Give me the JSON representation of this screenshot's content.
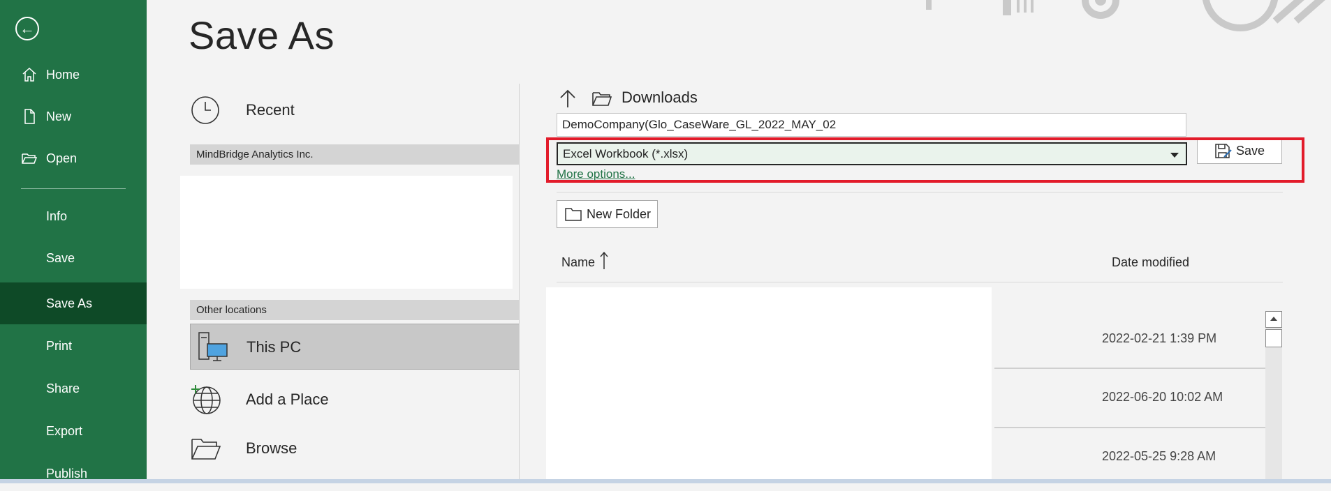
{
  "window": {
    "title": "Save As"
  },
  "sidebar": {
    "items": [
      {
        "label": "Home",
        "icon": "home-icon"
      },
      {
        "label": "New",
        "icon": "new-file-icon"
      },
      {
        "label": "Open",
        "icon": "open-folder-icon"
      },
      {
        "label": "Info"
      },
      {
        "label": "Save"
      },
      {
        "label": "Save As",
        "active": true
      },
      {
        "label": "Print"
      },
      {
        "label": "Share"
      },
      {
        "label": "Export"
      },
      {
        "label": "Publish"
      }
    ]
  },
  "locations": {
    "recent": "Recent",
    "group_org": "MindBridge Analytics Inc.",
    "group_other": "Other locations",
    "this_pc": "This PC",
    "add_place": "Add a Place",
    "browse": "Browse"
  },
  "save_pane": {
    "current_folder": "Downloads",
    "file_name": "DemoCompany(Glo_CaseWare_GL_2022_MAY_02",
    "file_type": "Excel Workbook (*.xlsx)",
    "save_label": "Save",
    "more_options": "More options...",
    "new_folder": "New Folder"
  },
  "file_list": {
    "columns": {
      "name": "Name",
      "date_modified": "Date modified"
    },
    "rows": [
      {
        "date": "2022-02-21 1:39 PM"
      },
      {
        "date": "2022-06-20 10:02 AM"
      },
      {
        "date": "2022-05-25 9:28 AM"
      }
    ]
  },
  "colors": {
    "brand": "#217346",
    "active": "#0e4a27",
    "highlight": "#e21b2a"
  }
}
